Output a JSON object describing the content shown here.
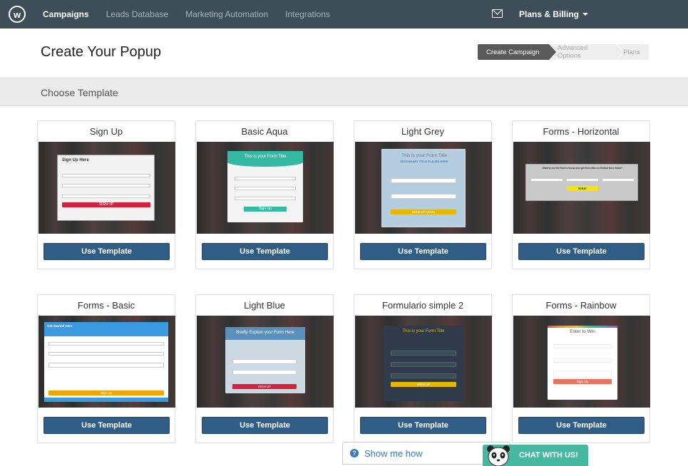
{
  "nav": {
    "logo_letter": "w",
    "links": [
      "Campaigns",
      "Leads Database",
      "Marketing Automation",
      "Integrations"
    ],
    "billing": "Plans & Billing"
  },
  "header": {
    "title": "Create Your Popup",
    "steps": [
      "Create Campaign",
      "Advanced Options",
      "Plans"
    ]
  },
  "section": {
    "title": "Choose Template"
  },
  "templates": [
    {
      "name": "Sign Up",
      "button": "Use Template"
    },
    {
      "name": "Basic Aqua",
      "button": "Use Template"
    },
    {
      "name": "Light Grey",
      "button": "Use Template"
    },
    {
      "name": "Forms - Horizontal",
      "button": "Use Template"
    },
    {
      "name": "Forms - Basic",
      "button": "Use Template"
    },
    {
      "name": "Light Blue",
      "button": "Use Template"
    },
    {
      "name": "Formulario simple 2",
      "button": "Use Template"
    },
    {
      "name": "Forms - Rainbow",
      "button": "Use Template"
    }
  ],
  "previews": {
    "signup": {
      "title": "Sign Up Here",
      "button": "SIGN UP"
    },
    "aqua": {
      "title": "This is your Form Title",
      "button": "Sign Up"
    },
    "grey": {
      "title": "This is your Form Title",
      "subtitle": "SECONDARY TITLE PLACED HERE",
      "button": "SIGN UP NOW!"
    },
    "horizontal": {
      "title": "Want to be the first to know and get first dibs on limited time deals?",
      "button": "Enter"
    },
    "basic": {
      "title": "Get Started Here",
      "button": "Sign Up"
    },
    "lightblue": {
      "title": "Briefly Explain your Form Here",
      "button": "SIGN UP"
    },
    "simple2": {
      "title": "This is your Form Title",
      "button": "SIGN UP"
    },
    "rainbow": {
      "title": "Enter to Win",
      "button": "Sign Up"
    }
  },
  "footer": {
    "help_text": "Show me how",
    "chat_text": "CHAT WITH US!"
  },
  "colors": {
    "nav_bg": "#3e4e59",
    "button": "#2f5d85",
    "chat": "#47b8a0",
    "help": "#3a7abf"
  }
}
